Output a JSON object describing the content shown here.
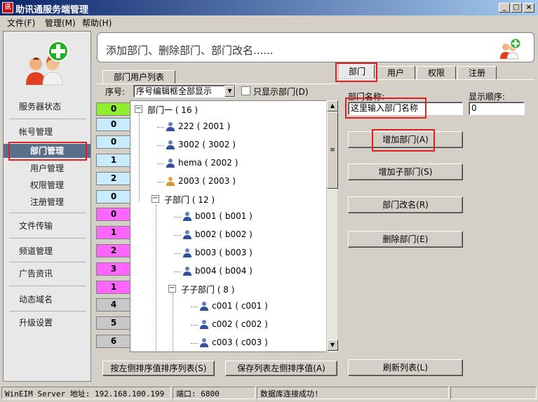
{
  "window": {
    "title": "助讯通服务端管理",
    "icon_text": "讯"
  },
  "menu": [
    "文件(F)",
    "管理(M)",
    "帮助(H)"
  ],
  "nav": {
    "server_status": "服务器状态",
    "account_mgmt": "帐号管理",
    "dept_mgmt": "部门管理",
    "user_mgmt": "用户管理",
    "perm_mgmt": "权限管理",
    "reg_mgmt": "注册管理",
    "file_transfer": "文件传输",
    "channel_mgmt": "频道管理",
    "ad_info": "广告资讯",
    "dynamic_dns": "动态域名",
    "upgrade": "升级设置"
  },
  "banner": {
    "text": "添加部门、删除部门、部门改名......"
  },
  "list_tab": "部门用户列表",
  "sort": {
    "label": "序号:",
    "dropdown_value": "序号编辑框全部显示",
    "checkbox_label": "只显示部门(D)"
  },
  "sort_counts": [
    {
      "value": "0",
      "color": "#90ee30"
    },
    {
      "value": "0",
      "color": "#c8ecfc"
    },
    {
      "value": "0",
      "color": "#c8ecfc"
    },
    {
      "value": "1",
      "color": "#c8ecfc"
    },
    {
      "value": "2",
      "color": "#c8ecfc"
    },
    {
      "value": "0",
      "color": "#c8ecfc"
    },
    {
      "value": "0",
      "color": "#ff66ff"
    },
    {
      "value": "1",
      "color": "#ff66ff"
    },
    {
      "value": "2",
      "color": "#ff66ff"
    },
    {
      "value": "3",
      "color": "#ff66ff"
    },
    {
      "value": "1",
      "color": "#ff66ff"
    },
    {
      "value": "4",
      "color": "#c8c8c8"
    },
    {
      "value": "5",
      "color": "#c8c8c8"
    },
    {
      "value": "6",
      "color": "#c8c8c8"
    }
  ],
  "tree": [
    {
      "label": "部门一 ( 16 )",
      "kind": "dept"
    },
    {
      "label": "222 ( 2001 )",
      "kind": "user"
    },
    {
      "label": "3002 ( 3002 )",
      "kind": "user"
    },
    {
      "label": "hema ( 2002 )",
      "kind": "user"
    },
    {
      "label": "2003 ( 2003 )",
      "kind": "user-female"
    },
    {
      "label": "子部门 ( 12 )",
      "kind": "dept"
    },
    {
      "label": "b001 ( b001 )",
      "kind": "user"
    },
    {
      "label": "b002 ( b002 )",
      "kind": "user"
    },
    {
      "label": "b003 ( b003 )",
      "kind": "user"
    },
    {
      "label": "b004 ( b004 )",
      "kind": "user"
    },
    {
      "label": "子子部门 ( 8 )",
      "kind": "dept"
    },
    {
      "label": "c001 ( c001 )",
      "kind": "user"
    },
    {
      "label": "c002 ( c002 )",
      "kind": "user"
    },
    {
      "label": "c003 ( c003 )",
      "kind": "user"
    }
  ],
  "bottom_buttons": {
    "sort_by_left": "按左侧排序值排序列表(S)",
    "save_sort": "保存列表左侧排序值(A)"
  },
  "tabs": [
    "部门",
    "用户",
    "权限",
    "注册"
  ],
  "dept_form": {
    "name_label": "部门名称:",
    "name_value": "这里输入部门名称",
    "order_label": "显示顺序:",
    "order_value": "0"
  },
  "actions": {
    "add_dept": "增加部门(A)",
    "add_subdept": "增加子部门(S)",
    "rename": "部门改名(R)",
    "delete": "删除部门(E)",
    "refresh": "刷新列表(L)"
  },
  "status": {
    "server": "WinEIM Server 地址: 192.168.100.199",
    "port": "端口: 6800",
    "db": "数据库连接成功!"
  },
  "colors": {
    "highlight": "#e02020",
    "selected_nav": "#5a6f8c",
    "title_start": "#0a246a",
    "title_end": "#a6caf0"
  }
}
